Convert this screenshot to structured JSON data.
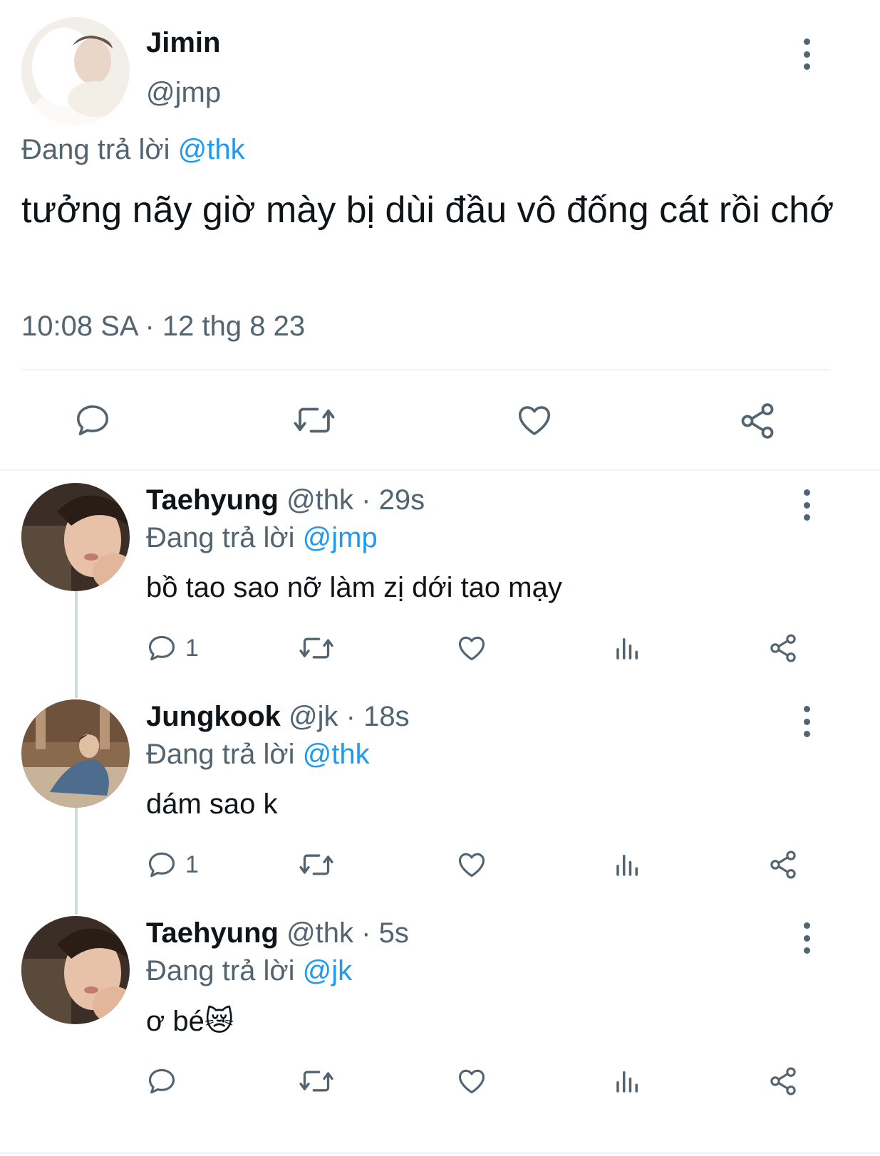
{
  "colors": {
    "accent": "#1d9bf0",
    "muted": "#536471",
    "text": "#0f1419",
    "divider": "#eff3f4"
  },
  "main_tweet": {
    "name": "Jimin",
    "handle": "@jmp",
    "replying_prefix": "Đang trả lời",
    "replying_to": "@thk",
    "text": "tưởng nãy giờ mày bị dùi đầu vô đống cát rồi chớ",
    "timestamp": "10:08 SA · 12 thg 8 23"
  },
  "replies": [
    {
      "name": "Taehyung",
      "handle": "@thk",
      "time": "· 29s",
      "replying_prefix": "Đang trả lời",
      "replying_to": "@jmp",
      "text": "bồ tao sao nỡ làm zị dới tao mạy",
      "reply_count": "1"
    },
    {
      "name": "Jungkook",
      "handle": "@jk",
      "time": "· 18s",
      "replying_prefix": "Đang trả lời",
      "replying_to": "@thk",
      "text": "dám sao k",
      "reply_count": "1"
    },
    {
      "name": "Taehyung",
      "handle": "@thk",
      "time": "· 5s",
      "replying_prefix": "Đang trả lời",
      "replying_to": "@jk",
      "text": "ơ bé",
      "emoji": "😿",
      "reply_count": ""
    }
  ]
}
